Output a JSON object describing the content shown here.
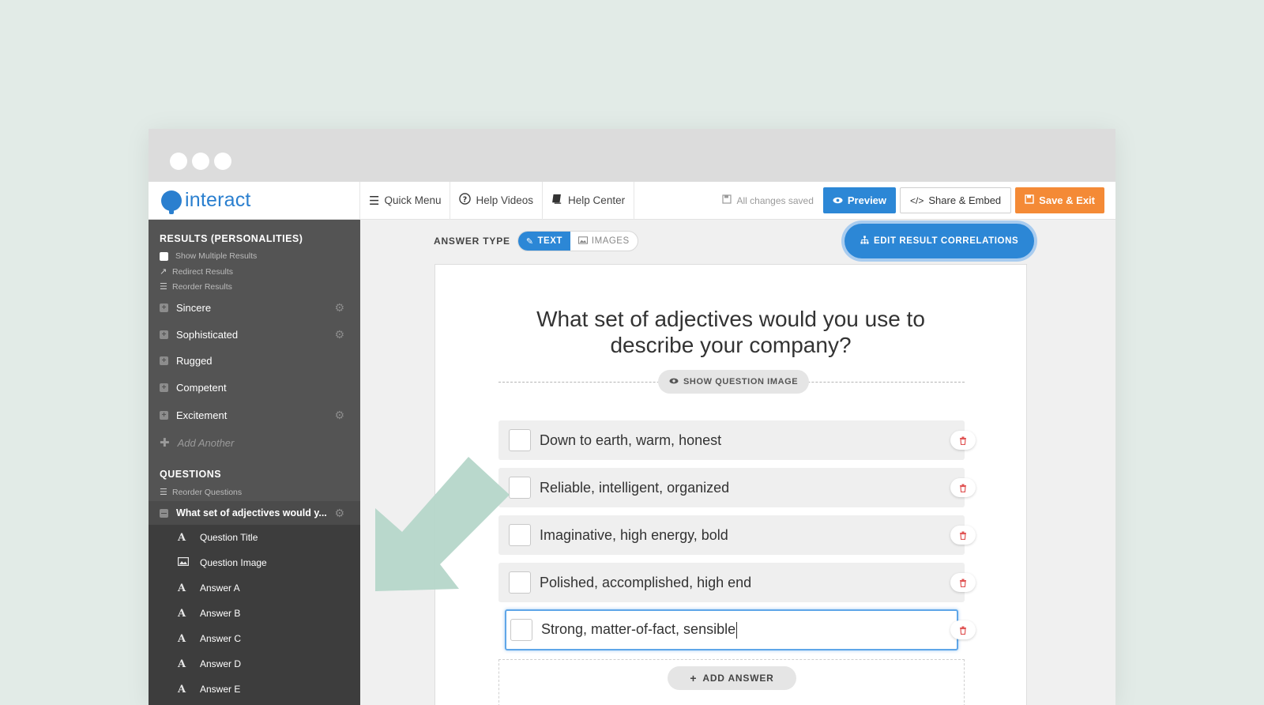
{
  "brand": {
    "name": "interact"
  },
  "nav": {
    "quick_menu": "Quick Menu",
    "help_videos": "Help Videos",
    "help_center": "Help Center"
  },
  "status": {
    "saved": "All changes saved"
  },
  "buttons": {
    "preview": "Preview",
    "share": "Share & Embed",
    "save_exit": "Save & Exit"
  },
  "sidebar": {
    "results_heading": "RESULTS (PERSONALITIES)",
    "options": [
      "Show Multiple Results",
      "Redirect Results",
      "Reorder Results"
    ],
    "results": [
      "Sincere",
      "Sophisticated",
      "Rugged",
      "Competent",
      "Excitement"
    ],
    "add_another": "Add Another",
    "questions_heading": "QUESTIONS",
    "reorder_questions": "Reorder Questions",
    "active_question": "What set of adjectives would y...",
    "sub_items": [
      {
        "icon": "A",
        "label": "Question Title"
      },
      {
        "icon": "image",
        "label": "Question Image"
      },
      {
        "icon": "A",
        "label": "Answer A"
      },
      {
        "icon": "A",
        "label": "Answer B"
      },
      {
        "icon": "A",
        "label": "Answer C"
      },
      {
        "icon": "A",
        "label": "Answer D"
      },
      {
        "icon": "A",
        "label": "Answer E"
      }
    ]
  },
  "editor": {
    "answer_type_label": "ANSWER TYPE",
    "type_text": "TEXT",
    "type_images": "IMAGES",
    "edit_correlations": "EDIT RESULT CORRELATIONS",
    "question_line1": "What set of adjectives would you use to",
    "question_line2": "describe your company?",
    "show_question_image": "SHOW QUESTION IMAGE",
    "answers": [
      "Down to earth, warm, honest",
      "Reliable, intelligent, organized",
      "Imaginative, high energy, bold",
      "Polished, accomplished, high end",
      "Strong, matter-of-fact, sensible"
    ],
    "add_answer": "ADD ANSWER"
  },
  "colors": {
    "background": "#e2ebe7",
    "brand_blue": "#2a7fcf",
    "primary_blue": "#2c87d6",
    "save_orange": "#f48a36",
    "sidebar_dark": "#545454",
    "arrow_mint": "#b5d6c9",
    "delete_red": "#e05555"
  }
}
